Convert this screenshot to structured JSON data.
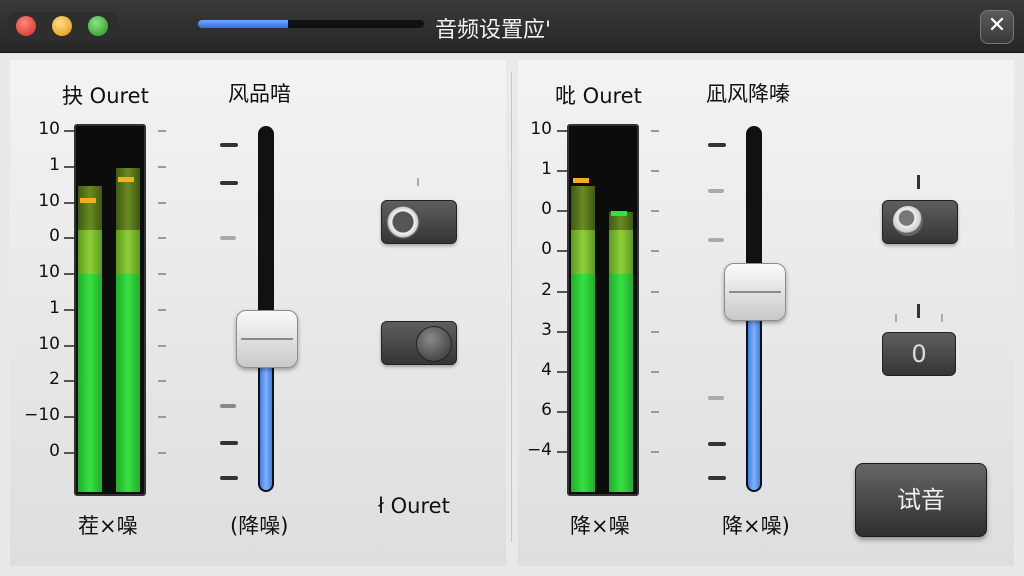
{
  "window": {
    "title": "音频设置应'",
    "progress_percent": 40,
    "close_label": "✕"
  },
  "left": {
    "meter_label": "抉 Ouret",
    "fader_label": "风品喑",
    "meter_caption": "茬×噪",
    "fader_caption": "(降噪)",
    "toggle_caption": "ł Ouret",
    "scale": [
      "10",
      "1",
      "10",
      "0",
      "10",
      "1",
      "10",
      "2",
      "−10",
      "0"
    ],
    "meter_level_a": 0.84,
    "meter_level_b": 0.89,
    "fader_level": 0.42
  },
  "right": {
    "meter_label": "吡 Ouret",
    "fader_label": "凪风降嗪",
    "meter_caption": "降×噪",
    "fader_caption": "降×噪)",
    "scale": [
      "10",
      "1",
      "0",
      "0",
      "2",
      "3",
      "4",
      "6",
      "−4"
    ],
    "meter_level_a": 0.84,
    "meter_level_b": 0.77,
    "fader_level": 0.55,
    "value_box": "0",
    "test_button": "试音"
  }
}
